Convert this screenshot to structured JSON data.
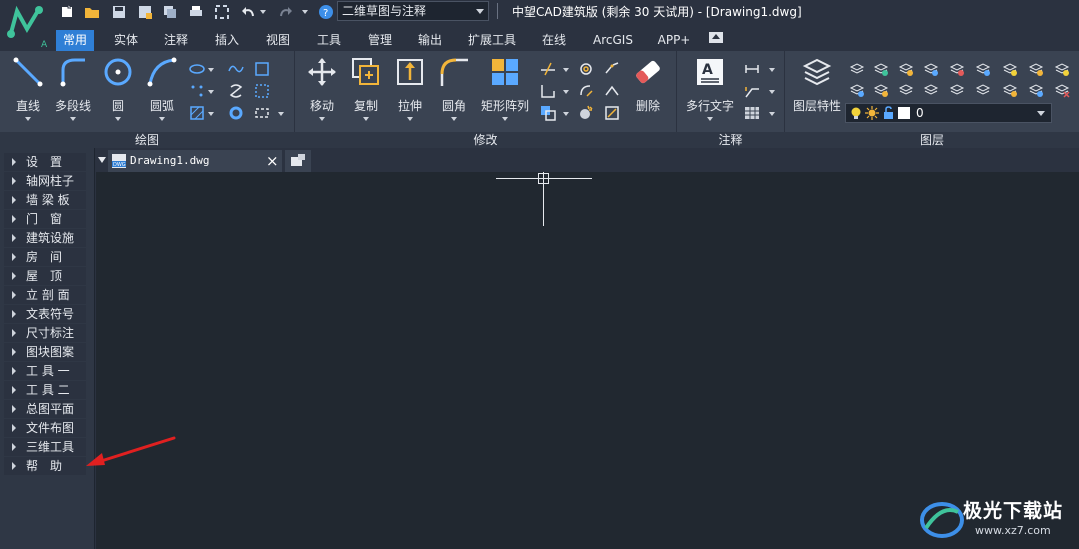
{
  "app": {
    "title": "中望CAD建筑版 (剩余 30 天试用) - [Drawing1.dwg]",
    "workspace": "二维草图与注释"
  },
  "tabs": [
    "常用",
    "实体",
    "注释",
    "插入",
    "视图",
    "工具",
    "管理",
    "输出",
    "扩展工具",
    "在线",
    "ArcGIS",
    "APP+"
  ],
  "active_tab": "常用",
  "ribbon": {
    "draw": {
      "label": "绘图",
      "buttons": [
        "直线",
        "多段线",
        "圆",
        "圆弧"
      ]
    },
    "modify": {
      "label": "修改",
      "buttons": [
        "移动",
        "复制",
        "拉伸",
        "圆角",
        "矩形阵列",
        "删除"
      ]
    },
    "annotation": {
      "label": "注释",
      "buttons": [
        "多行文字"
      ]
    },
    "layers": {
      "label": "图层",
      "buttons": [
        "图层特性"
      ],
      "current_layer": "0"
    }
  },
  "palette": [
    "设　置",
    "轴网柱子",
    "墙 梁 板",
    "门　窗",
    "建筑设施",
    "房　间",
    "屋　顶",
    "立 剖 面",
    "文表符号",
    "尺寸标注",
    "图块图案",
    "工 具 一",
    "工 具 二",
    "总图平面",
    "文件布图",
    "三维工具",
    "帮　助"
  ],
  "document": {
    "tab_name": "Drawing1.dwg",
    "close_glyph": "×"
  },
  "watermark": {
    "name": "极光下载站",
    "url": "www.xz7.com"
  },
  "colors": {
    "accent": "#2f7fd6",
    "arrow": "#e02020"
  }
}
